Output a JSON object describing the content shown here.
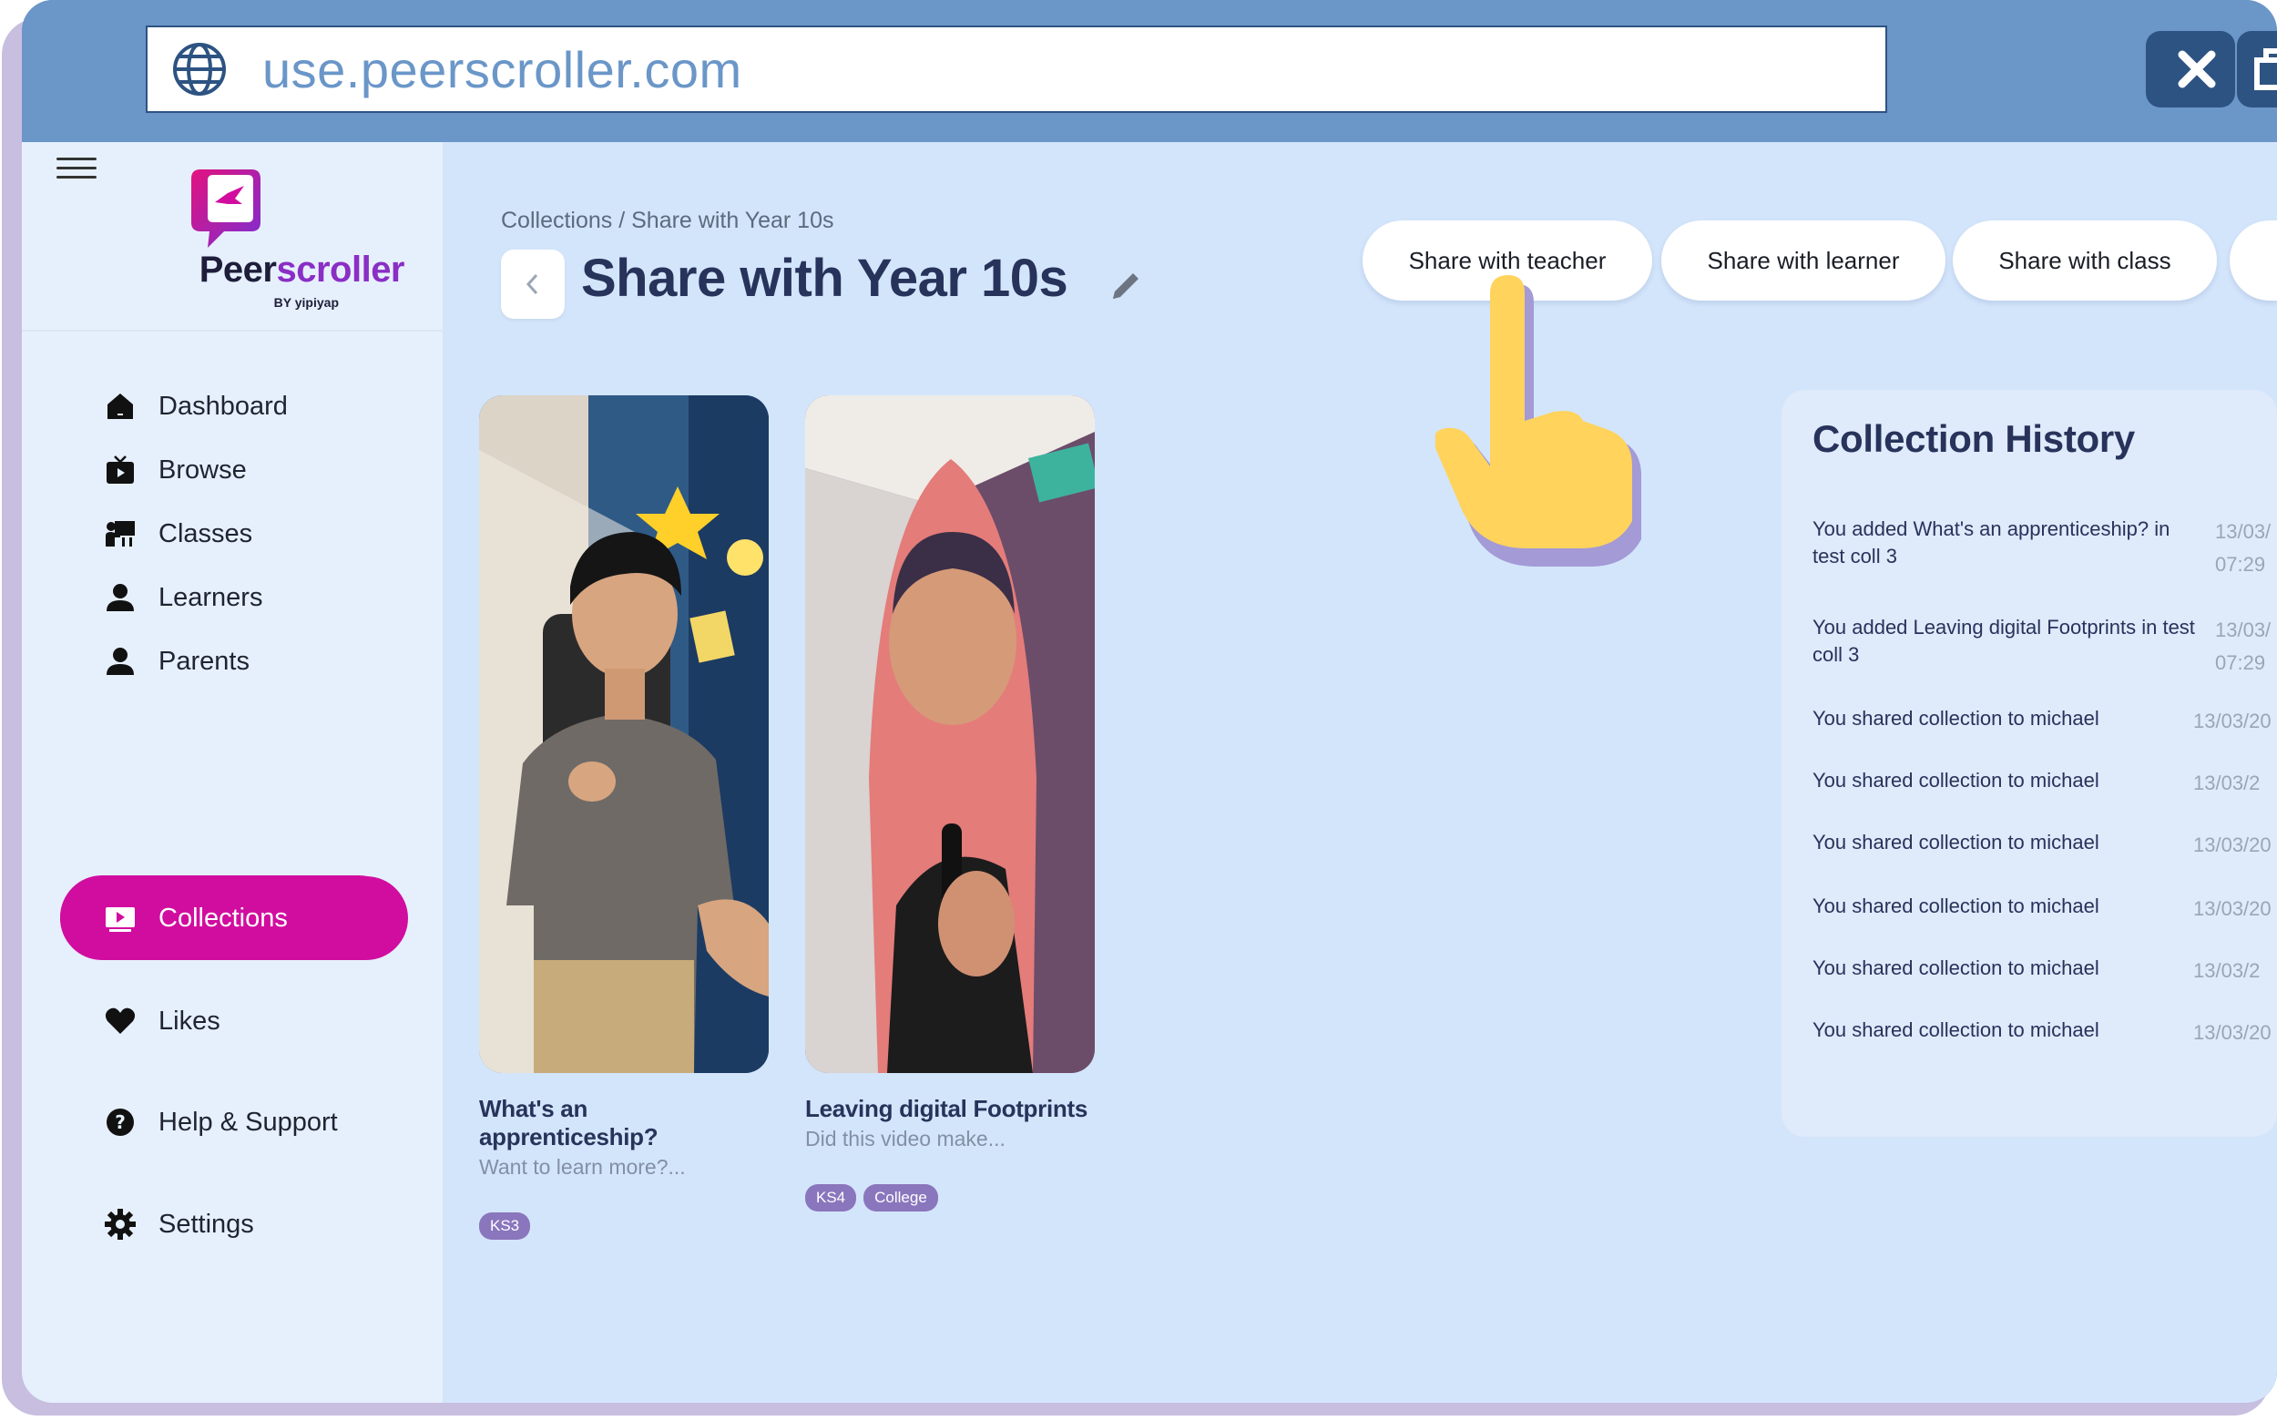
{
  "browser": {
    "url": "use.peerscroller.com",
    "icons": [
      "globe-icon",
      "minimize-icon",
      "restore-icon",
      "close-icon"
    ]
  },
  "logo": {
    "name_part1": "Peer",
    "name_part2": "scroller",
    "byline": "BY yipiyap"
  },
  "sidebar": {
    "items": [
      {
        "label": "Dashboard",
        "icon": "home-icon"
      },
      {
        "label": "Browse",
        "icon": "tv-icon"
      },
      {
        "label": "Classes",
        "icon": "classroom-icon"
      },
      {
        "label": "Learners",
        "icon": "person-icon"
      },
      {
        "label": "Parents",
        "icon": "person-icon"
      },
      {
        "label": "Collections",
        "icon": "play-screen-icon",
        "active": true
      },
      {
        "label": "Likes",
        "icon": "heart-icon"
      },
      {
        "label": "Help & Support",
        "icon": "help-icon"
      },
      {
        "label": "Settings",
        "icon": "gear-icon"
      }
    ],
    "active_color": "#d10d9f"
  },
  "main": {
    "breadcrumb": "Collections / Share with Year 10s",
    "title": "Share with Year 10s",
    "share_buttons": [
      "Share with teacher",
      "Share with learner",
      "Share with class"
    ],
    "videos": [
      {
        "title": "What's an apprenticeship?",
        "subtitle": "Want to learn more?...",
        "tags": [
          "KS3"
        ]
      },
      {
        "title": "Leaving digital Footprints",
        "subtitle": "Did this video make...",
        "tags": [
          "KS4",
          "College"
        ]
      }
    ]
  },
  "history": {
    "title": "Collection History",
    "entries": [
      {
        "text": "You added What's an apprenticeship? in test coll 3",
        "date": "13/03/",
        "time": "07:29"
      },
      {
        "text": "You added Leaving digital Footprints in test coll 3",
        "date": "13/03/",
        "time": "07:29"
      },
      {
        "text": "You shared collection to michael",
        "date": "13/03/20"
      },
      {
        "text": "You shared collection to michael",
        "date": "13/03/2"
      },
      {
        "text": "You shared collection to michael",
        "date": "13/03/20"
      },
      {
        "text": "You shared collection to michael",
        "date": "13/03/20"
      },
      {
        "text": "You shared collection to michael",
        "date": "13/03/2"
      },
      {
        "text": "You shared collection to michael",
        "date": "13/03/20"
      }
    ]
  },
  "colors": {
    "browser_chrome": "#6a96c8",
    "browser_button": "#2d5382",
    "app_background": "#d3e5fb",
    "title_text": "#27335a",
    "tag": "#8a76bd"
  }
}
